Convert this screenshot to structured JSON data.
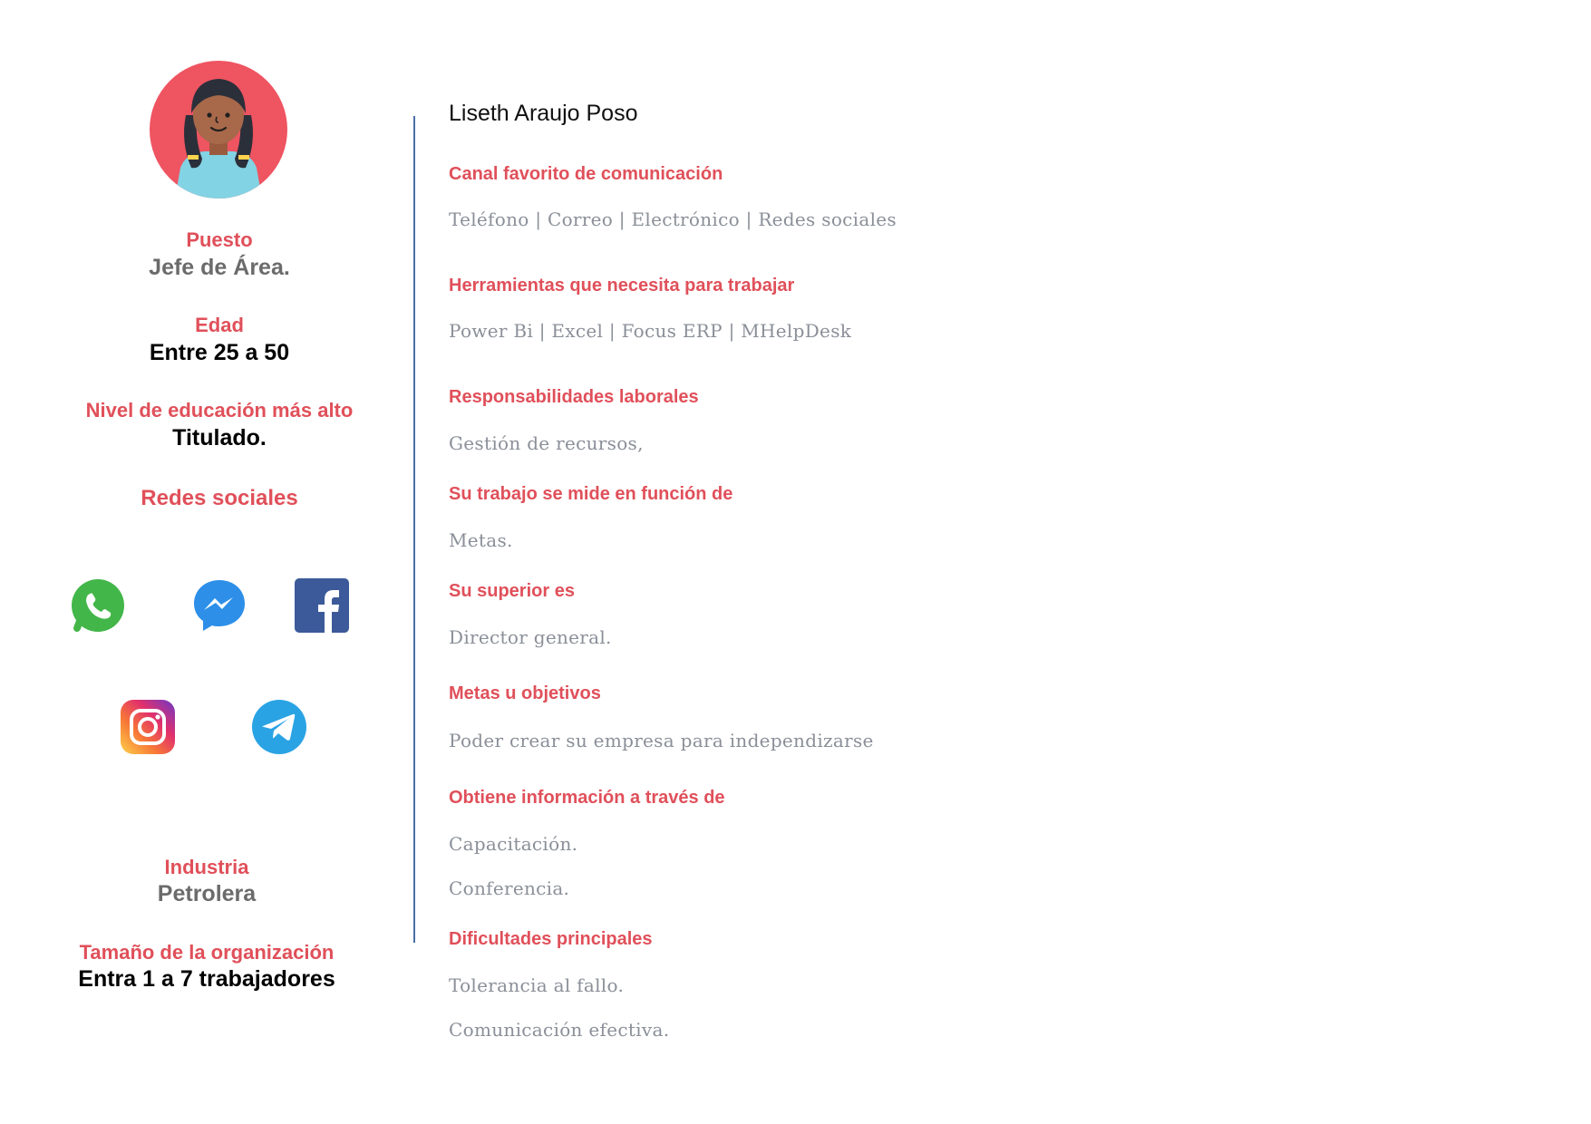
{
  "profile": {
    "name": "Liseth Araujo Poso",
    "position_label": "Puesto",
    "position_value": "Jefe de Área.",
    "age_label": "Edad",
    "age_value": "Entre 25 a 50",
    "education_label": "Nivel de educación más alto",
    "education_value": "Titulado.",
    "social_label": "Redes sociales",
    "social_icons": [
      "whatsapp-icon",
      "messenger-icon",
      "facebook-icon",
      "instagram-icon",
      "telegram-icon"
    ],
    "industry_label": "Industria",
    "industry_value": "Petrolera",
    "org_size_label": "Tamaño de la organización",
    "org_size_value": "Entra 1 a 7 trabajadores"
  },
  "details": {
    "channel_title": "Canal favorito de comunicación",
    "channel_text": "Teléfono | Correo | Electrónico | Redes sociales",
    "tools_title": "Herramientas que necesita para trabajar",
    "tools_text": "Power Bi | Excel | Focus ERP | MHelpDesk",
    "responsibilities_title": "Responsabilidades laborales",
    "responsibilities_text": "Gestión de recursos,",
    "measured_title": "Su trabajo se mide en función de",
    "measured_text": "Metas.",
    "superior_title": "Su superior es",
    "superior_text": "Director general.",
    "goals_title": "Metas u objetivos",
    "goals_text": "Poder crear su empresa para independizarse",
    "info_title": "Obtiene información a través de",
    "info_text_1": "Capacitación.",
    "info_text_2": "Conferencia.",
    "difficulties_title": "Dificultades principales",
    "difficulties_text_1": "Tolerancia al fallo.",
    "difficulties_text_2": "Comunicación efectiva."
  },
  "colors": {
    "accent": "#e0505a",
    "muted_text": "#8a8f98",
    "divider": "#4a6fa5"
  }
}
